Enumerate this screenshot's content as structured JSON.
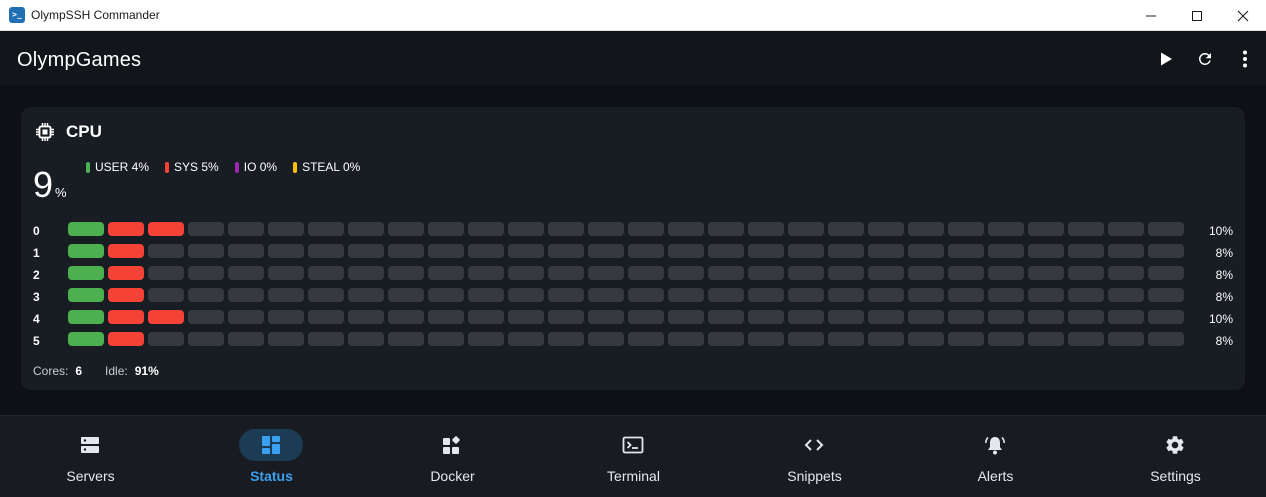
{
  "window": {
    "title": "OlympSSH Commander",
    "app_icon_glyph": ">_",
    "controls": [
      "minimize-icon",
      "maximize-icon",
      "close-icon"
    ]
  },
  "appbar": {
    "title": "OlympGames",
    "actions": [
      "play-icon",
      "refresh-icon",
      "more-vert-icon"
    ]
  },
  "cpu": {
    "title": "CPU",
    "icon": "chip-icon",
    "total_value": "9",
    "total_unit": "%",
    "legend": [
      {
        "label": "USER 4%",
        "color": "#4caf50"
      },
      {
        "label": "SYS 5%",
        "color": "#f44336"
      },
      {
        "label": "IO 0%",
        "color": "#9c27b0"
      },
      {
        "label": "STEAL 0%",
        "color": "#ffc107"
      }
    ],
    "segments_per_row": 28,
    "cores": [
      {
        "id": "0",
        "user": 1,
        "sys": 2,
        "percent": "10%"
      },
      {
        "id": "1",
        "user": 1,
        "sys": 1,
        "percent": "8%"
      },
      {
        "id": "2",
        "user": 1,
        "sys": 1,
        "percent": "8%"
      },
      {
        "id": "3",
        "user": 1,
        "sys": 1,
        "percent": "8%"
      },
      {
        "id": "4",
        "user": 1,
        "sys": 2,
        "percent": "10%"
      },
      {
        "id": "5",
        "user": 1,
        "sys": 1,
        "percent": "8%"
      }
    ],
    "stats": {
      "cores_label": "Cores:",
      "cores_value": "6",
      "idle_label": "Idle:",
      "idle_value": "91%"
    }
  },
  "nav": {
    "items": [
      {
        "label": "Servers",
        "icon": "servers-icon",
        "active": false
      },
      {
        "label": "Status",
        "icon": "dashboard-icon",
        "active": true
      },
      {
        "label": "Docker",
        "icon": "docker-widgets-icon",
        "active": false
      },
      {
        "label": "Terminal",
        "icon": "terminal-icon",
        "active": false
      },
      {
        "label": "Snippets",
        "icon": "code-icon",
        "active": false
      },
      {
        "label": "Alerts",
        "icon": "bell-icon",
        "active": false
      },
      {
        "label": "Settings",
        "icon": "gear-icon",
        "active": false
      }
    ]
  },
  "colors": {
    "accent": "#3aa0f0",
    "user": "#4caf50",
    "sys": "#f44336",
    "io": "#9c27b0",
    "steal": "#ffc107",
    "empty_segment": "#363a40"
  }
}
